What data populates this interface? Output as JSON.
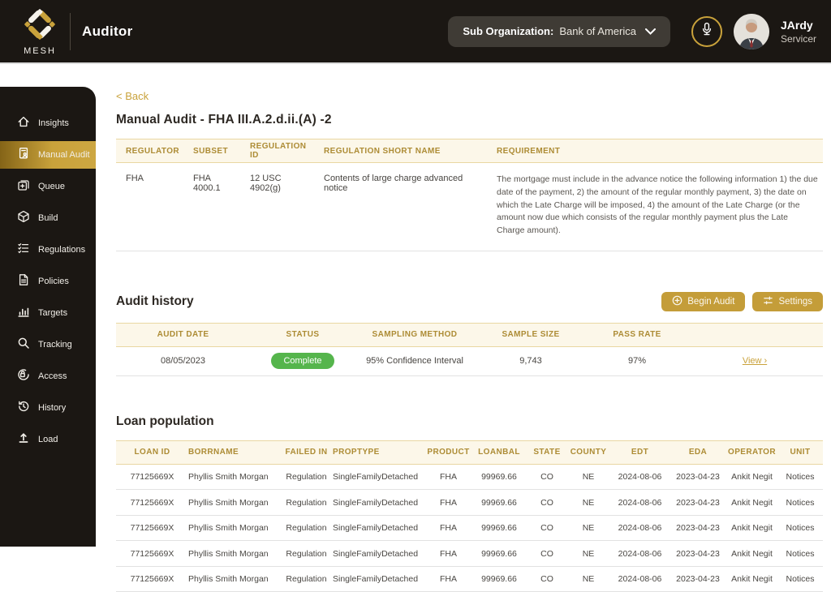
{
  "colors": {
    "accent_gold": "#c9a23b",
    "dark_bg": "#1b1713",
    "header_text_gold": "#ad8c35",
    "header_bg_cream": "#fcf7e9",
    "status_green": "#55b54c"
  },
  "topbar": {
    "brand": "MESH",
    "app_title": "Auditor",
    "sub_org_label": "Sub Organization:",
    "sub_org_value": "Bank of America",
    "user_name": "JArdy",
    "user_role": "Servicer"
  },
  "sidebar": {
    "items": [
      {
        "label": "Insights",
        "icon": "home-icon",
        "active": false
      },
      {
        "label": "Manual Audit",
        "icon": "manual-audit-icon",
        "active": true
      },
      {
        "label": "Queue",
        "icon": "queue-icon",
        "active": false
      },
      {
        "label": "Build",
        "icon": "cube-icon",
        "active": false
      },
      {
        "label": "Regulations",
        "icon": "checklist-icon",
        "active": false
      },
      {
        "label": "Policies",
        "icon": "policies-icon",
        "active": false
      },
      {
        "label": "Targets",
        "icon": "bar-chart-icon",
        "active": false
      },
      {
        "label": "Tracking",
        "icon": "search-icon",
        "active": false
      },
      {
        "label": "Access",
        "icon": "lock-icon",
        "active": false
      },
      {
        "label": "History",
        "icon": "history-icon",
        "active": false
      },
      {
        "label": "Load",
        "icon": "upload-icon",
        "active": false
      }
    ]
  },
  "main": {
    "back_label": "< Back",
    "page_title": "Manual Audit - FHA III.A.2.d.ii.(A) -2",
    "regulation_table": {
      "headers": [
        "REGULATOR",
        "SUBSET",
        "REGULATION ID",
        "REGULATION SHORT NAME",
        "REQUIREMENT"
      ],
      "row": {
        "regulator": "FHA",
        "subset": "FHA 4000.1",
        "regulation_id": "12 USC 4902(g)",
        "short_name": "Contents of large charge advanced notice",
        "requirement": "The mortgage must include in the advance notice the following information 1) the due date of the payment, 2) the amount of the regular monthly payment, 3) the date on which the Late Charge will be imposed, 4) the amount of the Late Charge (or the amount now due which consists of the regular monthly payment plus the Late Charge amount)."
      }
    },
    "audit_history": {
      "title": "Audit history",
      "begin_audit_label": "Begin Audit",
      "settings_label": "Settings",
      "headers": [
        "AUDIT DATE",
        "STATUS",
        "SAMPLING METHOD",
        "SAMPLE SIZE",
        "PASS RATE",
        ""
      ],
      "row": {
        "audit_date": "08/05/2023",
        "status": "Complete",
        "sampling_method": "95% Confidence Interval",
        "sample_size": "9,743",
        "pass_rate": "97%",
        "view_label": "View ›"
      }
    },
    "loan_population": {
      "title": "Loan population",
      "headers": [
        "LOAN ID",
        "BORRNAME",
        "FAILED IN",
        "PROPTYPE",
        "PRODUCT",
        "LOANBAL",
        "STATE",
        "COUNTY",
        "EDT",
        "EDA",
        "OPERATOR",
        "UNIT"
      ],
      "rows": [
        [
          "77125669X",
          "Phyllis Smith Morgan",
          "Regulation",
          "SingleFamilyDetached",
          "FHA",
          "99969.66",
          "CO",
          "NE",
          "2024-08-06",
          "2023-04-23",
          "Ankit Negit",
          "Notices"
        ],
        [
          "77125669X",
          "Phyllis Smith Morgan",
          "Regulation",
          "SingleFamilyDetached",
          "FHA",
          "99969.66",
          "CO",
          "NE",
          "2024-08-06",
          "2023-04-23",
          "Ankit Negit",
          "Notices"
        ],
        [
          "77125669X",
          "Phyllis Smith Morgan",
          "Regulation",
          "SingleFamilyDetached",
          "FHA",
          "99969.66",
          "CO",
          "NE",
          "2024-08-06",
          "2023-04-23",
          "Ankit Negit",
          "Notices"
        ],
        [
          "77125669X",
          "Phyllis Smith Morgan",
          "Regulation",
          "SingleFamilyDetached",
          "FHA",
          "99969.66",
          "CO",
          "NE",
          "2024-08-06",
          "2023-04-23",
          "Ankit Negit",
          "Notices"
        ],
        [
          "77125669X",
          "Phyllis Smith Morgan",
          "Regulation",
          "SingleFamilyDetached",
          "FHA",
          "99969.66",
          "CO",
          "NE",
          "2024-08-06",
          "2023-04-23",
          "Ankit Negit",
          "Notices"
        ]
      ]
    }
  }
}
